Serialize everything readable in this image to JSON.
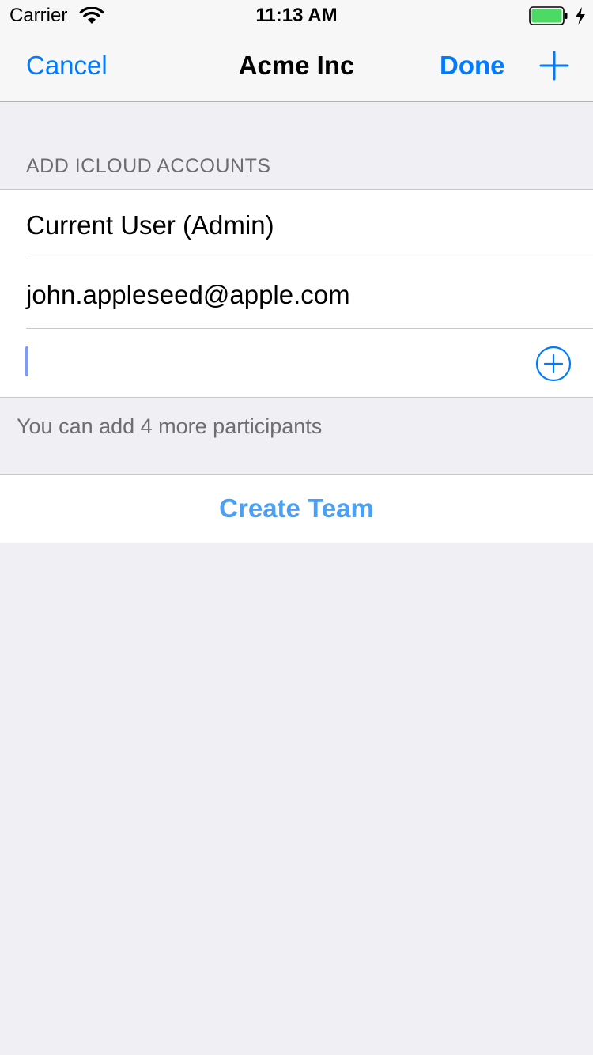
{
  "status_bar": {
    "carrier": "Carrier",
    "time": "11:13 AM",
    "icons": [
      "wifi-icon",
      "battery-icon",
      "charging-bolt-icon"
    ],
    "battery_color": "#4cd964"
  },
  "nav": {
    "cancel_label": "Cancel",
    "title": "Acme Inc",
    "done_label": "Done",
    "add_icon": "plus-icon",
    "accent_color": "#007aff"
  },
  "accounts_section": {
    "header": "ADD ICLOUD ACCOUNTS",
    "participants": [
      "Current User (Admin)",
      "john.appleseed@apple.com"
    ],
    "new_participant_input": {
      "value": "",
      "placeholder": ""
    },
    "add_icon": "add-circle-icon",
    "footer": "You can add 4 more participants"
  },
  "actions": {
    "create_team_label": "Create Team",
    "create_team_color": "#4aa0f5"
  }
}
